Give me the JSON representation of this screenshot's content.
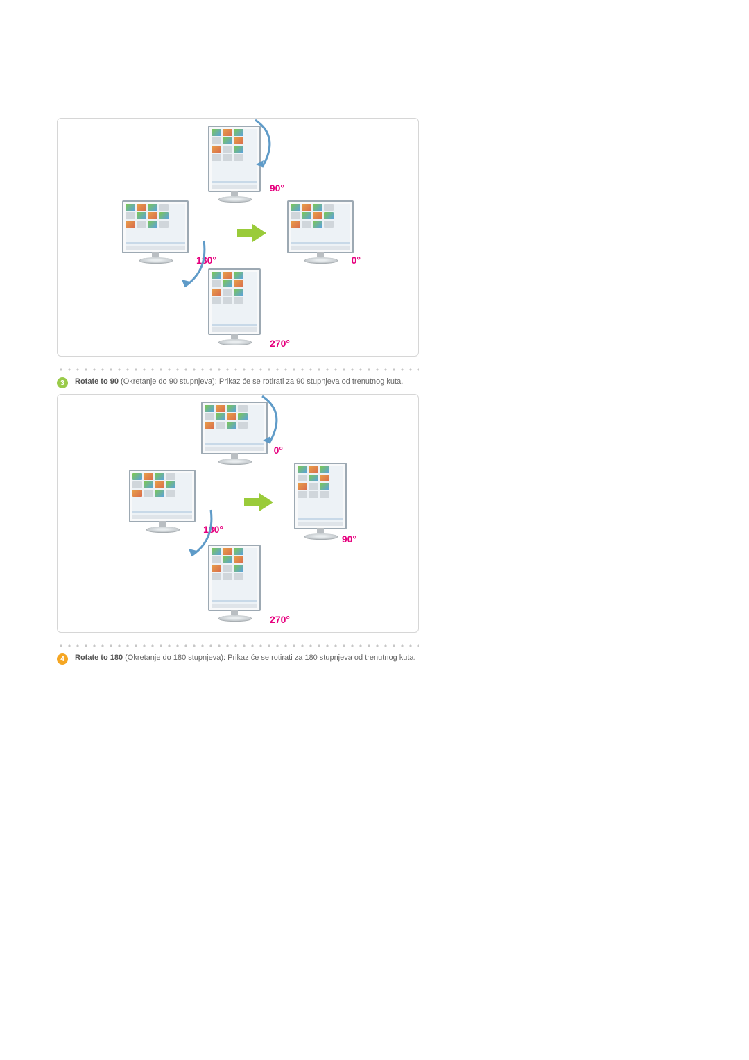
{
  "section3": {
    "number": "3",
    "title": "Rotate to 90",
    "subtitle": " (Okretanje do 90 stupnjeva): Prikaz će se rotirati za 90 stupnjeva od trenutnog kuta.",
    "angles": {
      "top": "90°",
      "left": "180°",
      "right": "0°",
      "bottom": "270°"
    }
  },
  "section4": {
    "number": "4",
    "title": "Rotate to 180",
    "subtitle": " (Okretanje do 180 stupnjeva): Prikaz će se rotirati za 180 stupnjeva od trenutnog kuta.",
    "angles": {
      "top": "0°",
      "left": "180°",
      "right": "90°",
      "bottom": "270°"
    }
  }
}
